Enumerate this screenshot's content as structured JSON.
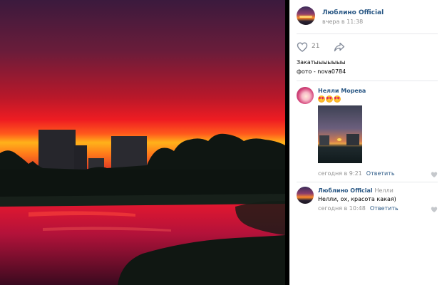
{
  "post": {
    "author": "Люблино Official",
    "time": "вчера в 11:38",
    "likes": "21",
    "text_line1": "Закатыыыыыыы",
    "text_line2": "фото - nova0784"
  },
  "comments": [
    {
      "author": "Нелли Морева",
      "emoji": [
        "heart-eyes-emoji",
        "heart-eyes-emoji",
        "heart-eyes-emoji"
      ],
      "time": "сегодня в 9:21",
      "reply_label": "Ответить",
      "has_photo": true
    },
    {
      "author": "Люблино Official",
      "reply_to": "Нелли",
      "text": "Нелли, ох, красота какая)",
      "time": "сегодня в 10:48",
      "reply_label": "Ответить"
    }
  ],
  "colors": {
    "link": "#2a5885",
    "meta": "#939393",
    "divider": "#e7e8ec"
  },
  "icons": {
    "like": "heart-icon",
    "share": "share-arrow-icon"
  }
}
